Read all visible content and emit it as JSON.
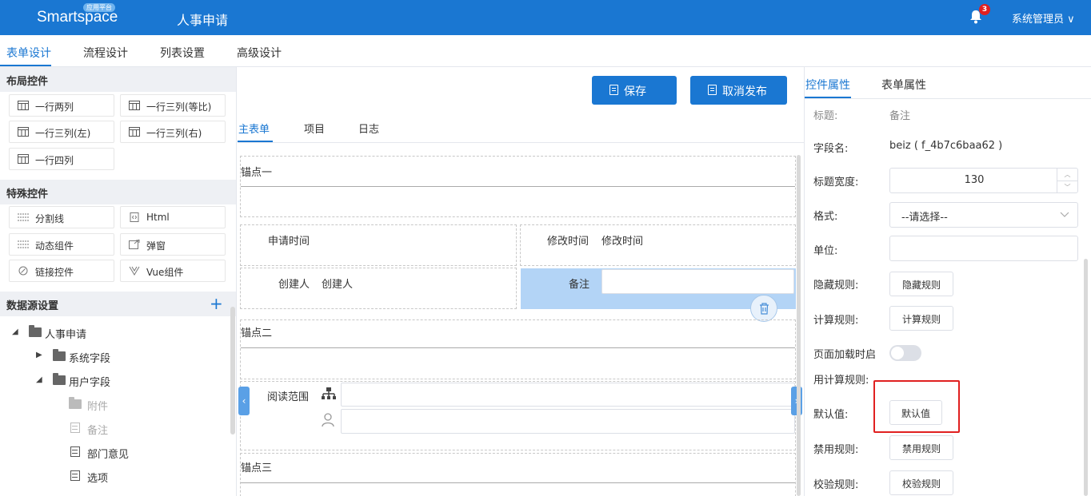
{
  "header": {
    "logo_text": "Smartspace",
    "logo_badge": "应用平台",
    "app_title": "人事申请",
    "notification_count": "3",
    "user_menu": "系统管理员"
  },
  "main_tabs": [
    "表单设计",
    "流程设计",
    "列表设置",
    "高级设计"
  ],
  "left_panel": {
    "layout_title": "布局控件",
    "layout_controls": [
      "一行两列",
      "一行三列(等比)",
      "一行三列(左)",
      "一行三列(右)",
      "一行四列"
    ],
    "special_title": "特殊控件",
    "special_controls": [
      "分割线",
      "Html",
      "动态组件",
      "弹窗",
      "链接控件",
      "Vue组件"
    ],
    "datasource_title": "数据源设置",
    "tree": {
      "root": "人事申请",
      "system_fields": "系统字段",
      "user_fields": "用户字段",
      "items": [
        "附件",
        "备注",
        "部门意见",
        "选项"
      ]
    }
  },
  "center": {
    "save_label": "保存",
    "unpublish_label": "取消发布",
    "tabs": [
      "主表单",
      "项目",
      "日志"
    ],
    "anchor1": "锚点一",
    "anchor2": "锚点二",
    "anchor3": "锚点三",
    "apply_time_label": "申请时间",
    "modify_time_label": "修改时间",
    "modify_time_value": "修改时间",
    "creator_label": "创建人",
    "creator_value": "创建人",
    "remark_label": "备注",
    "read_scope_label": "阅读范围"
  },
  "right_panel": {
    "tabs": [
      "控件属性",
      "表单属性"
    ],
    "title_label": "标题:",
    "title_value": "备注",
    "field_name_label": "字段名:",
    "field_name_value": "beiz ( f_4b7c6baa62 )",
    "title_width_label": "标题宽度:",
    "title_width_value": "130",
    "format_label": "格式:",
    "format_placeholder": "--请选择--",
    "unit_label": "单位:",
    "hide_rule_label": "隐藏规则:",
    "hide_rule_button": "隐藏规则",
    "calc_rule_label": "计算规则:",
    "calc_rule_button": "计算规则",
    "onload_label_1": "页面加载时启",
    "onload_label_2": "用计算规则:",
    "default_label": "默认值:",
    "default_button": "默认值",
    "disable_rule_label": "禁用规则:",
    "disable_rule_button": "禁用规则",
    "validate_rule_label": "校验规则:",
    "validate_rule_button": "校验规则",
    "onload_enabled": false
  },
  "colors": {
    "primary": "#1a77d2",
    "highlight": "#e02020",
    "selected": "#b3d4f6"
  }
}
